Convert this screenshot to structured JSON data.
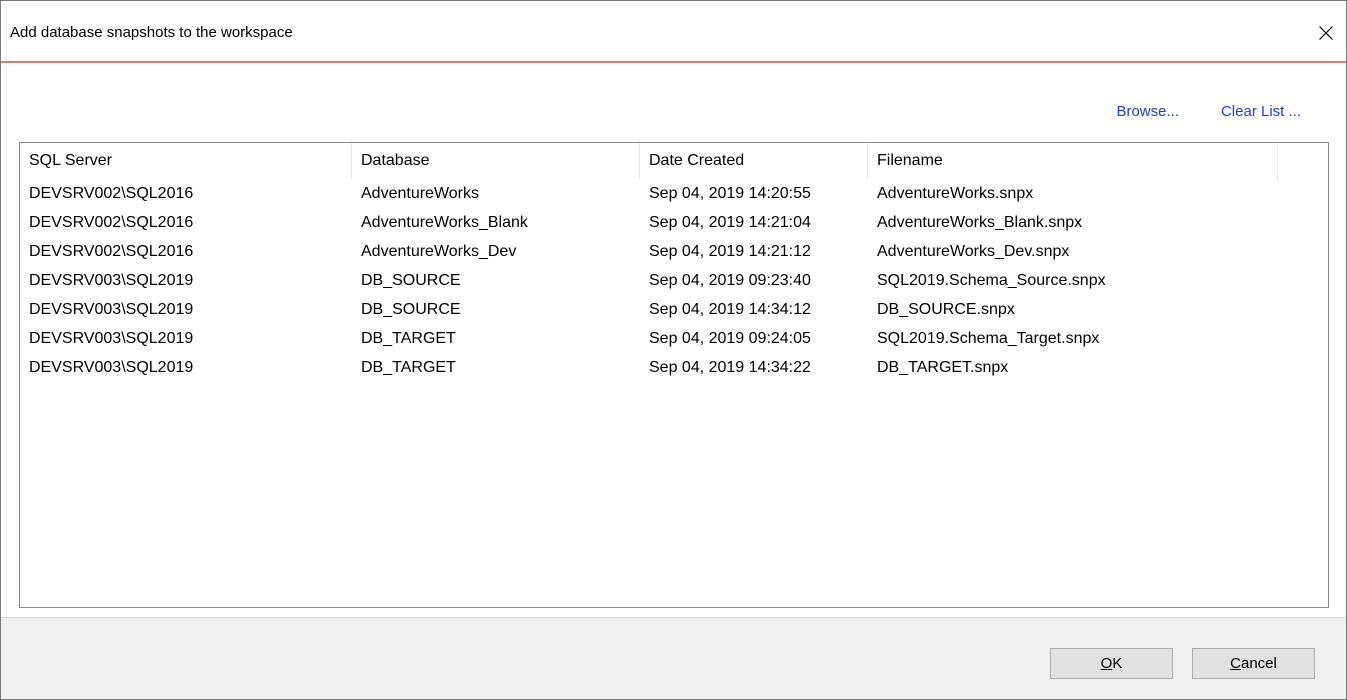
{
  "dialog": {
    "title": "Add database snapshots to the workspace"
  },
  "toolbar": {
    "browse_label": "Browse...",
    "clear_list_label": "Clear List ..."
  },
  "list": {
    "columns": [
      "SQL Server",
      "Database",
      "Date Created",
      "Filename"
    ],
    "rows": [
      [
        "DEVSRV002\\SQL2016",
        "AdventureWorks",
        "Sep 04, 2019 14:20:55",
        "AdventureWorks.snpx"
      ],
      [
        "DEVSRV002\\SQL2016",
        "AdventureWorks_Blank",
        "Sep 04, 2019 14:21:04",
        "AdventureWorks_Blank.snpx"
      ],
      [
        "DEVSRV002\\SQL2016",
        "AdventureWorks_Dev",
        "Sep 04, 2019 14:21:12",
        "AdventureWorks_Dev.snpx"
      ],
      [
        "DEVSRV003\\SQL2019",
        "DB_SOURCE",
        "Sep 04, 2019 09:23:40",
        "SQL2019.Schema_Source.snpx"
      ],
      [
        "DEVSRV003\\SQL2019",
        "DB_SOURCE",
        "Sep 04, 2019 14:34:12",
        "DB_SOURCE.snpx"
      ],
      [
        "DEVSRV003\\SQL2019",
        "DB_TARGET",
        "Sep 04, 2019 09:24:05",
        "SQL2019.Schema_Target.snpx"
      ],
      [
        "DEVSRV003\\SQL2019",
        "DB_TARGET",
        "Sep 04, 2019 14:34:22",
        "DB_TARGET.snpx"
      ]
    ]
  },
  "buttons": {
    "ok": {
      "mnemonic": "O",
      "rest": "K"
    },
    "cancel": {
      "mnemonic": "C",
      "rest": "ancel"
    }
  },
  "icons": {
    "close": "close-icon"
  },
  "colors": {
    "title_accent": "#e07878",
    "link": "#1a3fd6",
    "footer_bg": "#f0f0f0"
  }
}
